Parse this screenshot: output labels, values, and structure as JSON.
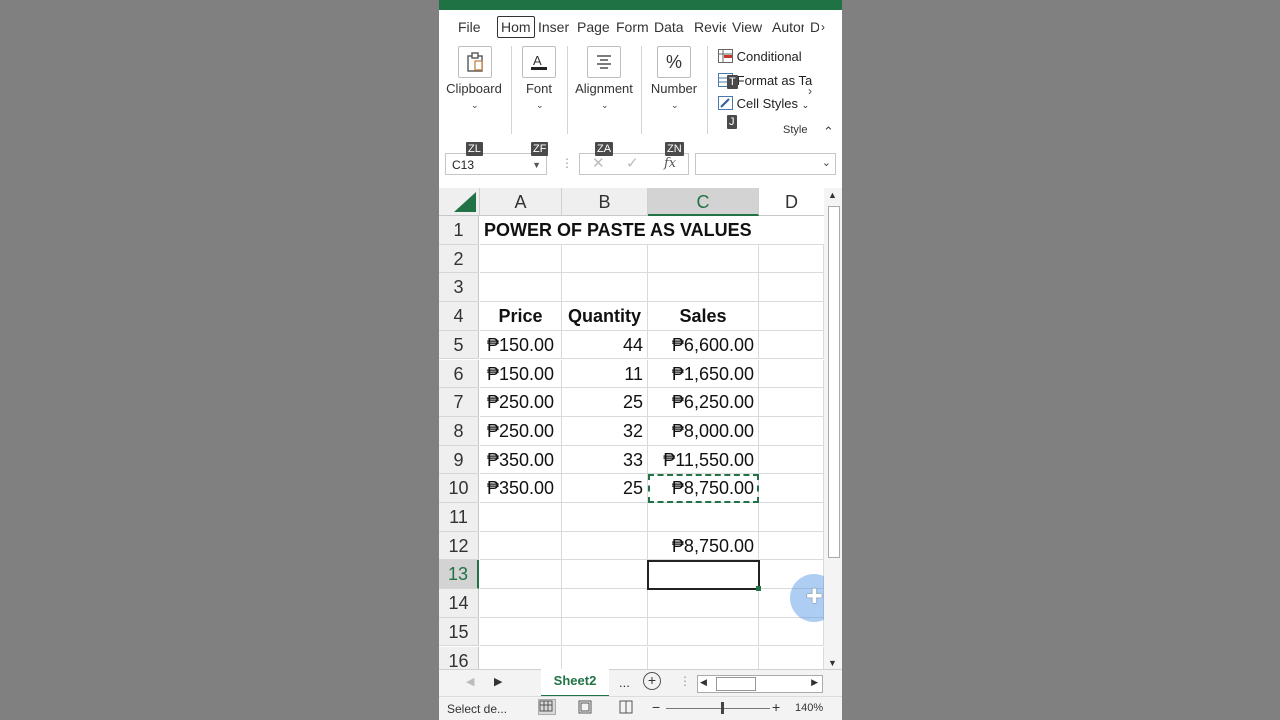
{
  "ribbon_tabs": [
    "File",
    "Hom",
    "Inser",
    "Page",
    "Form",
    "Data",
    "Revie",
    "View",
    "Autor",
    "D"
  ],
  "ribbon_tabs_overflow": "›",
  "groups": {
    "clipboard": "Clipboard",
    "font": "Font",
    "alignment": "Alignment",
    "number": "Number",
    "styles": "Style"
  },
  "styles_items": {
    "conditional": "Conditional",
    "format_as_table": "Format as Ta",
    "cell_styles": "Cell Styles"
  },
  "keytips": {
    "t": "T",
    "j": "J",
    "zl": "ZL",
    "zf": "ZF",
    "za": "ZA",
    "zn": "ZN"
  },
  "name_box": "C13",
  "fx_label": "fx",
  "columns": [
    "A",
    "B",
    "C",
    "D"
  ],
  "rows": [
    {
      "n": "1",
      "a": "POWER OF PASTE AS VALUES",
      "b": "",
      "c": ""
    },
    {
      "n": "2",
      "a": "",
      "b": "",
      "c": ""
    },
    {
      "n": "3",
      "a": "",
      "b": "",
      "c": ""
    },
    {
      "n": "4",
      "a": "Price",
      "b": "Quantity",
      "c": "Sales"
    },
    {
      "n": "5",
      "a": "₱150.00",
      "b": "44",
      "c": "₱6,600.00"
    },
    {
      "n": "6",
      "a": "₱150.00",
      "b": "11",
      "c": "₱1,650.00"
    },
    {
      "n": "7",
      "a": "₱250.00",
      "b": "25",
      "c": "₱6,250.00"
    },
    {
      "n": "8",
      "a": "₱250.00",
      "b": "32",
      "c": "₱8,000.00"
    },
    {
      "n": "9",
      "a": "₱350.00",
      "b": "33",
      "c": "₱11,550.00"
    },
    {
      "n": "10",
      "a": "₱350.00",
      "b": "25",
      "c": "₱8,750.00"
    },
    {
      "n": "11",
      "a": "",
      "b": "",
      "c": ""
    },
    {
      "n": "12",
      "a": "",
      "b": "",
      "c": "₱8,750.00"
    },
    {
      "n": "13",
      "a": "",
      "b": "",
      "c": ""
    },
    {
      "n": "14",
      "a": "",
      "b": "",
      "c": ""
    },
    {
      "n": "15",
      "a": "",
      "b": "",
      "c": ""
    },
    {
      "n": "16",
      "a": "",
      "b": "",
      "c": ""
    }
  ],
  "sheet_tab": "Sheet2",
  "sheet_more": "...",
  "status_text": "Select de...",
  "zoom": "140%",
  "colors": {
    "accent": "#217346",
    "cursor": "#4a90e2"
  }
}
